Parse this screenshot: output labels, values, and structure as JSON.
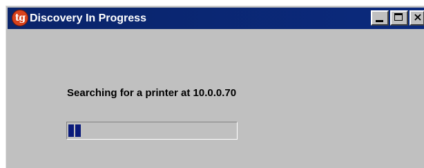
{
  "window": {
    "title": "Discovery In Progress",
    "app_icon_text": "tg",
    "controls": {
      "minimize": "minimize",
      "maximize": "maximize",
      "close": "×"
    }
  },
  "content": {
    "message": "Searching for a printer at 10.0.0.70",
    "progress": {
      "blocks": 2,
      "fraction": 0.06
    }
  },
  "colors": {
    "titlebar": "#0a246a",
    "window_bg": "#c0c0c0",
    "progress_fill": "#0a1a7a",
    "app_icon": "#d8421c"
  },
  "icons": {
    "app": "tg-app-icon",
    "minimize": "minimize-icon",
    "maximize": "maximize-icon",
    "close": "close-icon"
  }
}
